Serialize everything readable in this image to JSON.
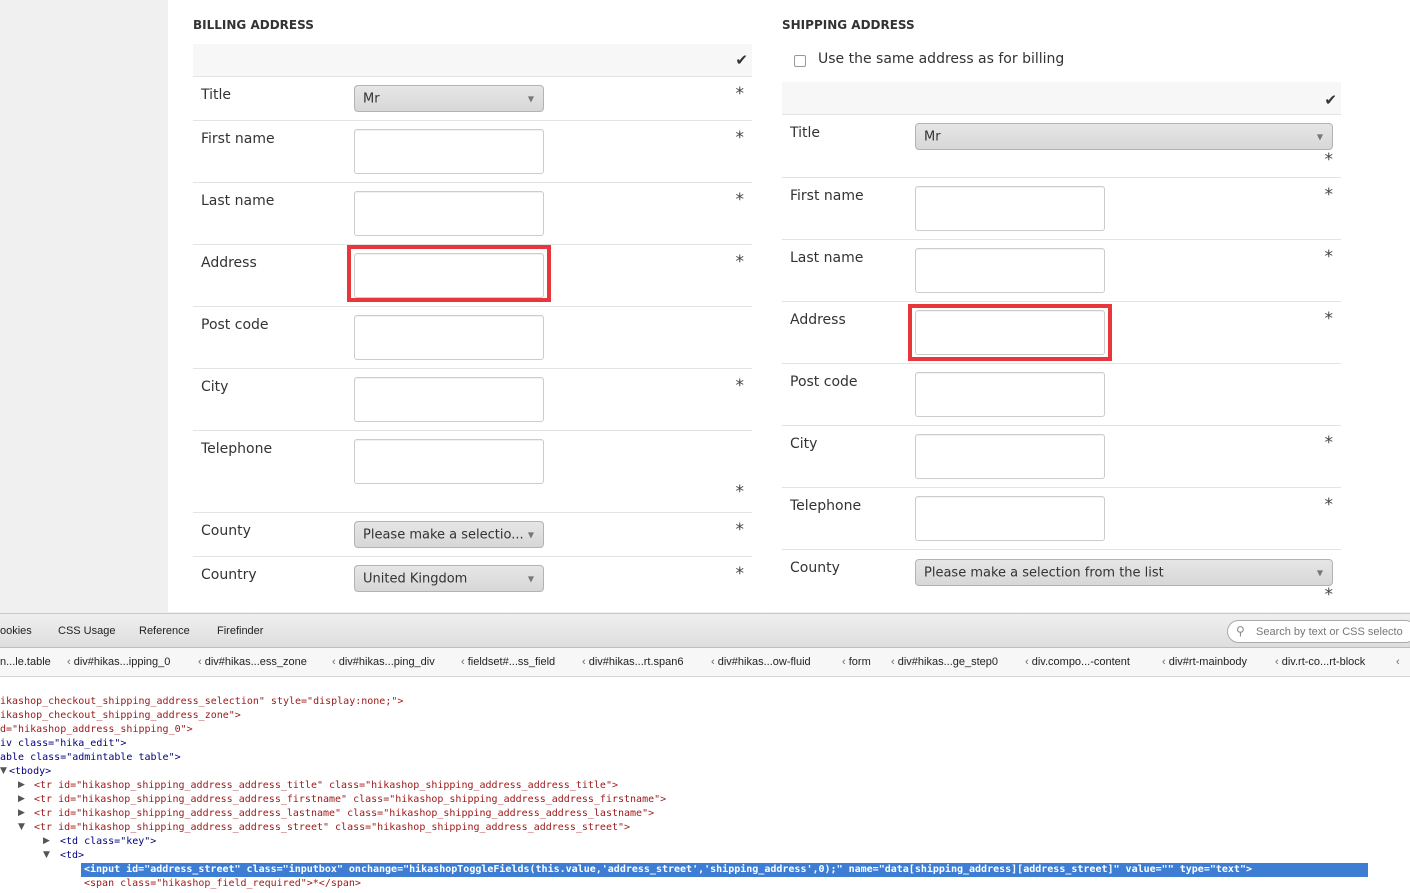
{
  "billing": {
    "heading": "BILLING ADDRESS",
    "fields": [
      {
        "label": "Title",
        "type": "select",
        "value": "Mr",
        "required": "*"
      },
      {
        "label": "First name",
        "type": "text",
        "value": "",
        "required": "*"
      },
      {
        "label": "Last name",
        "type": "text",
        "value": "",
        "required": "*"
      },
      {
        "label": "Address",
        "type": "text",
        "value": "",
        "required": "*",
        "highlighted": true
      },
      {
        "label": "Post code",
        "type": "text",
        "value": "",
        "required": ""
      },
      {
        "label": "City",
        "type": "text",
        "value": "",
        "required": "*"
      },
      {
        "label": "Telephone",
        "type": "text",
        "value": "",
        "required": "*"
      },
      {
        "label": "County",
        "type": "select",
        "value": "Please make a selectio...",
        "required": "*"
      },
      {
        "label": "Country",
        "type": "select",
        "value": "United Kingdom",
        "required": "*"
      }
    ]
  },
  "shipping": {
    "heading": "SHIPPING ADDRESS",
    "same_as_billing_label": "Use the same address as for billing",
    "same_as_billing_checked": false,
    "fields": [
      {
        "label": "Title",
        "type": "select",
        "value": "Mr",
        "required": "*"
      },
      {
        "label": "First name",
        "type": "text",
        "value": "",
        "required": "*"
      },
      {
        "label": "Last name",
        "type": "text",
        "value": "",
        "required": "*"
      },
      {
        "label": "Address",
        "type": "text",
        "value": "",
        "required": "*",
        "highlighted": true
      },
      {
        "label": "Post code",
        "type": "text",
        "value": "",
        "required": ""
      },
      {
        "label": "City",
        "type": "text",
        "value": "",
        "required": "*"
      },
      {
        "label": "Telephone",
        "type": "text",
        "value": "",
        "required": "*"
      },
      {
        "label": "County",
        "type": "select",
        "value": "Please make a selection from the list",
        "required": "*"
      }
    ]
  },
  "devtools": {
    "tabs": [
      "ookies",
      "CSS Usage",
      "Reference",
      "Firefinder"
    ],
    "search_placeholder": "Search by text or CSS selecto",
    "breadcrumbs": [
      "n...le.table",
      "div#hikas...ipping_0",
      "div#hikas...ess_zone",
      "div#hikas...ping_div",
      "fieldset#...ss_field",
      "div#hikas...rt.span6",
      "div#hikas...ow-fluid",
      "form",
      "div#hikas...ge_step0",
      "div.compo...-content",
      "div#rt-mainbody",
      "div.rt-co...rt-block"
    ],
    "code_lines": [
      "ikashop_checkout_shipping_address_selection\" style=\"display:none;\">",
      "ikashop_checkout_shipping_address_zone\">",
      "d=\"hikashop_address_shipping_0\">",
      "iv class=\"hika_edit\">",
      "able class=\"admintable table\">",
      "<tbody>",
      "<tr id=\"hikashop_shipping_address_address_title\" class=\"hikashop_shipping_address_address_title\">",
      "<tr id=\"hikashop_shipping_address_address_firstname\" class=\"hikashop_shipping_address_address_firstname\">",
      "<tr id=\"hikashop_shipping_address_address_lastname\" class=\"hikashop_shipping_address_address_lastname\">",
      "<tr id=\"hikashop_shipping_address_address_street\" class=\"hikashop_shipping_address_address_street\">",
      "<td class=\"key\">",
      "<td>",
      "<input id=\"address_street\" class=\"inputbox\" onchange=\"hikashopToggleFields(this.value,'address_street','shipping_address',0);\" name=\"data[shipping_address][address_street]\" value=\"\" type=\"text\">",
      "<span class=\"hikashop_field_required\">*</span>"
    ]
  }
}
